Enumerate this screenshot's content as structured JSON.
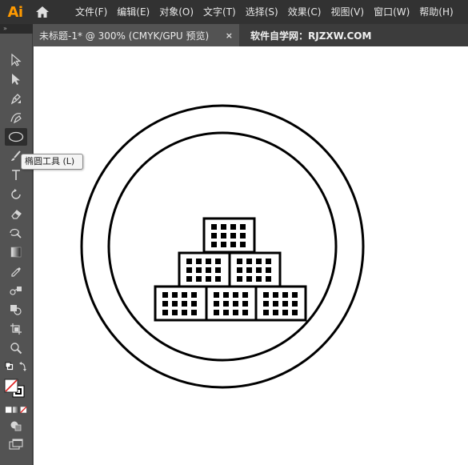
{
  "app": {
    "logo": "Ai"
  },
  "menu": [
    "文件(F)",
    "编辑(E)",
    "对象(O)",
    "文字(T)",
    "选择(S)",
    "效果(C)",
    "视图(V)",
    "窗口(W)",
    "帮助(H)"
  ],
  "tabs": {
    "active": {
      "label": "未标题-1* @ 300% (CMYK/GPU 预览)",
      "close": "×"
    },
    "watermark": "软件自学网：RJZXW.COM"
  },
  "toolbar": {
    "collapse": "»",
    "tools": [
      "selection-tool",
      "direct-selection-tool",
      "pen-tool",
      "curvature-tool",
      "ellipse-tool",
      "paintbrush-tool",
      "type-tool",
      "rotate-tool",
      "eraser-tool",
      "warp-tool",
      "gradient-tool",
      "eyedropper-tool",
      "blend-tool",
      "shape-builder-tool",
      "artboard-tool",
      "zoom-tool",
      "swap-fill-stroke",
      "fill-stroke",
      "color-modes",
      "draw-modes",
      "screen-mode"
    ]
  },
  "tooltip": {
    "text": "椭圆工具 (L)"
  },
  "colors": {
    "menubar": "#323232",
    "toolbar": "#535353",
    "canvas": "#ffffff",
    "logo": "#ff9a00"
  }
}
